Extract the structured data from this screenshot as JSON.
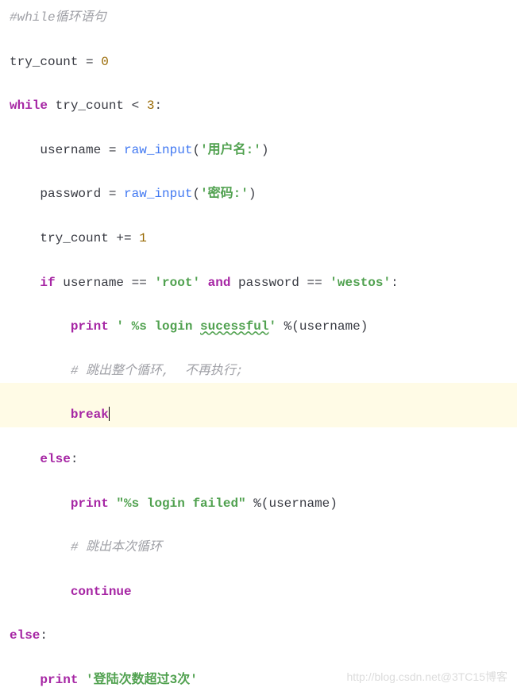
{
  "code": {
    "line1": {
      "comment": "#while循环语句"
    },
    "line2": {
      "var": "try_count",
      "op": " = ",
      "num": "0"
    },
    "line3": {
      "kw": "while",
      "var": " try_count ",
      "op": "< ",
      "num": "3",
      "colon": ":"
    },
    "line4": {
      "var": "username",
      "op": " = ",
      "fn": "raw_input",
      "lparen": "(",
      "str": "'用户名:'",
      "rparen": ")"
    },
    "line5": {
      "var": "password",
      "op": " = ",
      "fn": "raw_input",
      "lparen": "(",
      "str": "'密码:'",
      "rparen": ")"
    },
    "line6": {
      "var": "try_count",
      "op": " += ",
      "num": "1"
    },
    "line7": {
      "kw1": "if",
      "var1": " username ",
      "op1": "== ",
      "str1": "'root'",
      "kw2": " and",
      "var2": " password ",
      "op2": "== ",
      "str2": "'westos'",
      "colon": ":"
    },
    "line8": {
      "kw": "print",
      "str1": " ' %s login ",
      "str2": "sucessful",
      "str3": "'",
      "op": " %",
      "lparen": "(",
      "var": "username",
      "rparen": ")"
    },
    "line9": {
      "comment": "# 跳出整个循环,  不再执行;"
    },
    "line10": {
      "kw": "break"
    },
    "line11": {
      "kw": "else",
      "colon": ":"
    },
    "line12": {
      "kw": "print",
      "str": " \"%s login failed\"",
      "op": " %",
      "lparen": "(",
      "var": "username",
      "rparen": ")"
    },
    "line13": {
      "comment": "# 跳出本次循环"
    },
    "line14": {
      "kw": "continue"
    },
    "line15": {
      "kw": "else",
      "colon": ":"
    },
    "line16": {
      "kw": "print",
      "str": " '登陆次数超过3次'"
    }
  },
  "watermark": "http://blog.csdn.net@3TC15博客"
}
